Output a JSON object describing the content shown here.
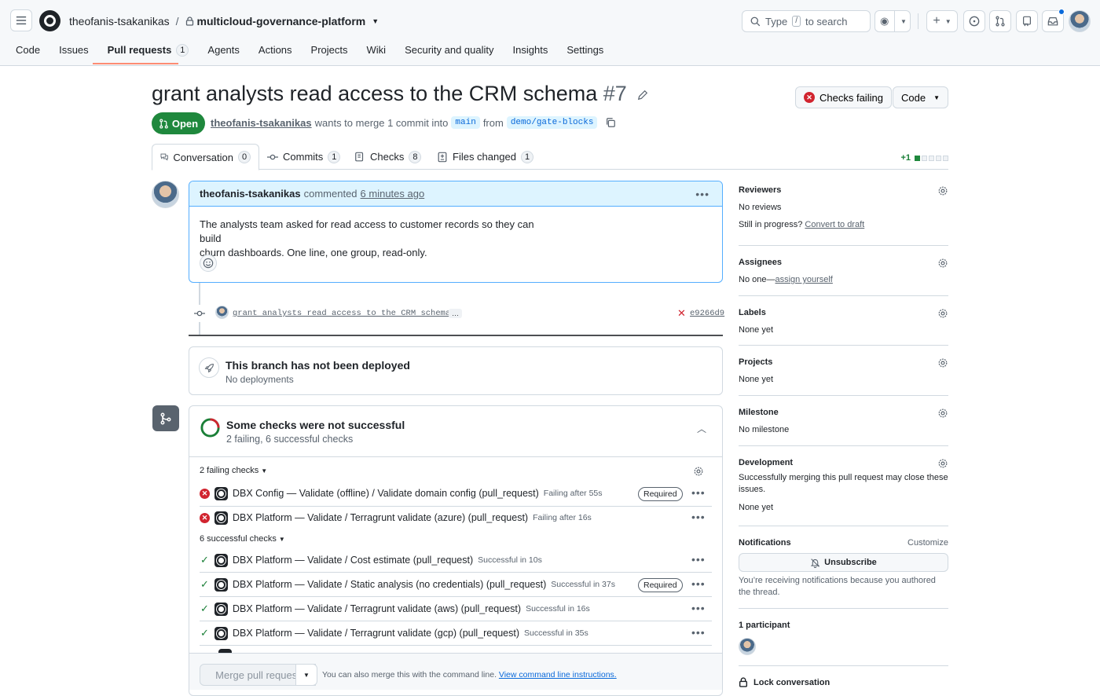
{
  "header": {
    "owner": "theofanis-tsakanikas",
    "separator": "/",
    "repo": "multicloud-governance-platform",
    "search_prefix": "Type",
    "search_key": "/",
    "search_suffix": "to search"
  },
  "nav": {
    "tabs": [
      {
        "label": "Code"
      },
      {
        "label": "Issues"
      },
      {
        "label": "Pull requests",
        "count": "1"
      },
      {
        "label": "Agents"
      },
      {
        "label": "Actions"
      },
      {
        "label": "Projects"
      },
      {
        "label": "Wiki"
      },
      {
        "label": "Security and quality"
      },
      {
        "label": "Insights"
      },
      {
        "label": "Settings"
      }
    ]
  },
  "pr": {
    "title": "grant analysts read access to the CRM schema",
    "number": "#7",
    "checks_btn": "Checks failing",
    "code_btn": "Code",
    "state": "Open",
    "author": "theofanis-tsakanikas",
    "merge_text": "wants to merge 1 commit into",
    "base": "main",
    "from": "from",
    "head": "demo/gate-blocks",
    "diffstat": "+1"
  },
  "prtabs": [
    {
      "label": "Conversation",
      "count": "0"
    },
    {
      "label": "Commits",
      "count": "1"
    },
    {
      "label": "Checks",
      "count": "8"
    },
    {
      "label": "Files changed",
      "count": "1"
    }
  ],
  "comment": {
    "author": "theofanis-tsakanikas",
    "action": "commented",
    "time": "6 minutes ago",
    "body_line1": "The analysts team asked for read access to customer records so they can build",
    "body_line2": "churn dashboards. One line, one group, read-only."
  },
  "commit": {
    "message": "grant analysts read access to the CRM schema",
    "ellipsis": "…",
    "sha": "e9266d9"
  },
  "deploy": {
    "title": "This branch has not been deployed",
    "subtitle": "No deployments"
  },
  "checks": {
    "title": "Some checks were not successful",
    "subtitle": "2 failing, 6 successful checks",
    "failing_header": "2 failing checks",
    "successful_header": "6 successful checks",
    "required": "Required",
    "failing": [
      {
        "name": "DBX Config — Validate (offline) / Validate domain config (pull_request)",
        "duration": "Failing after 55s",
        "required": true
      },
      {
        "name": "DBX Platform — Validate / Terragrunt validate (azure) (pull_request)",
        "duration": "Failing after 16s",
        "required": false
      }
    ],
    "successful": [
      {
        "name": "DBX Platform — Validate / Cost estimate (pull_request)",
        "duration": "Successful in 10s",
        "required": false
      },
      {
        "name": "DBX Platform — Validate / Static analysis (no credentials) (pull_request)",
        "duration": "Successful in 37s",
        "required": true
      },
      {
        "name": "DBX Platform — Validate / Terragrunt validate (aws) (pull_request)",
        "duration": "Successful in 16s",
        "required": false
      },
      {
        "name": "DBX Platform — Validate / Terragrunt validate (gcp) (pull_request)",
        "duration": "Successful in 35s",
        "required": false
      }
    ]
  },
  "merge": {
    "button": "Merge pull request",
    "hint": "You can also merge this with the command line.",
    "link": "View command line instructions."
  },
  "sidebar": {
    "reviewers": {
      "label": "Reviewers",
      "value": "No reviews",
      "draft_prefix": "Still in progress?",
      "draft_link": "Convert to draft"
    },
    "assignees": {
      "label": "Assignees",
      "value": "No one—",
      "link": "assign yourself"
    },
    "labels": {
      "label": "Labels",
      "value": "None yet"
    },
    "projects": {
      "label": "Projects",
      "value": "None yet"
    },
    "milestone": {
      "label": "Milestone",
      "value": "No milestone"
    },
    "development": {
      "label": "Development",
      "desc": "Successfully merging this pull request may close these issues.",
      "value": "None yet"
    },
    "notifications": {
      "label": "Notifications",
      "customize": "Customize",
      "button": "Unsubscribe",
      "desc": "You’re receiving notifications because you authored the thread."
    },
    "participants": {
      "label": "1 participant"
    },
    "lock": {
      "label": "Lock conversation"
    }
  },
  "colors": {
    "accent": "#0969da",
    "success": "#1f883d",
    "danger": "#d1242f"
  }
}
